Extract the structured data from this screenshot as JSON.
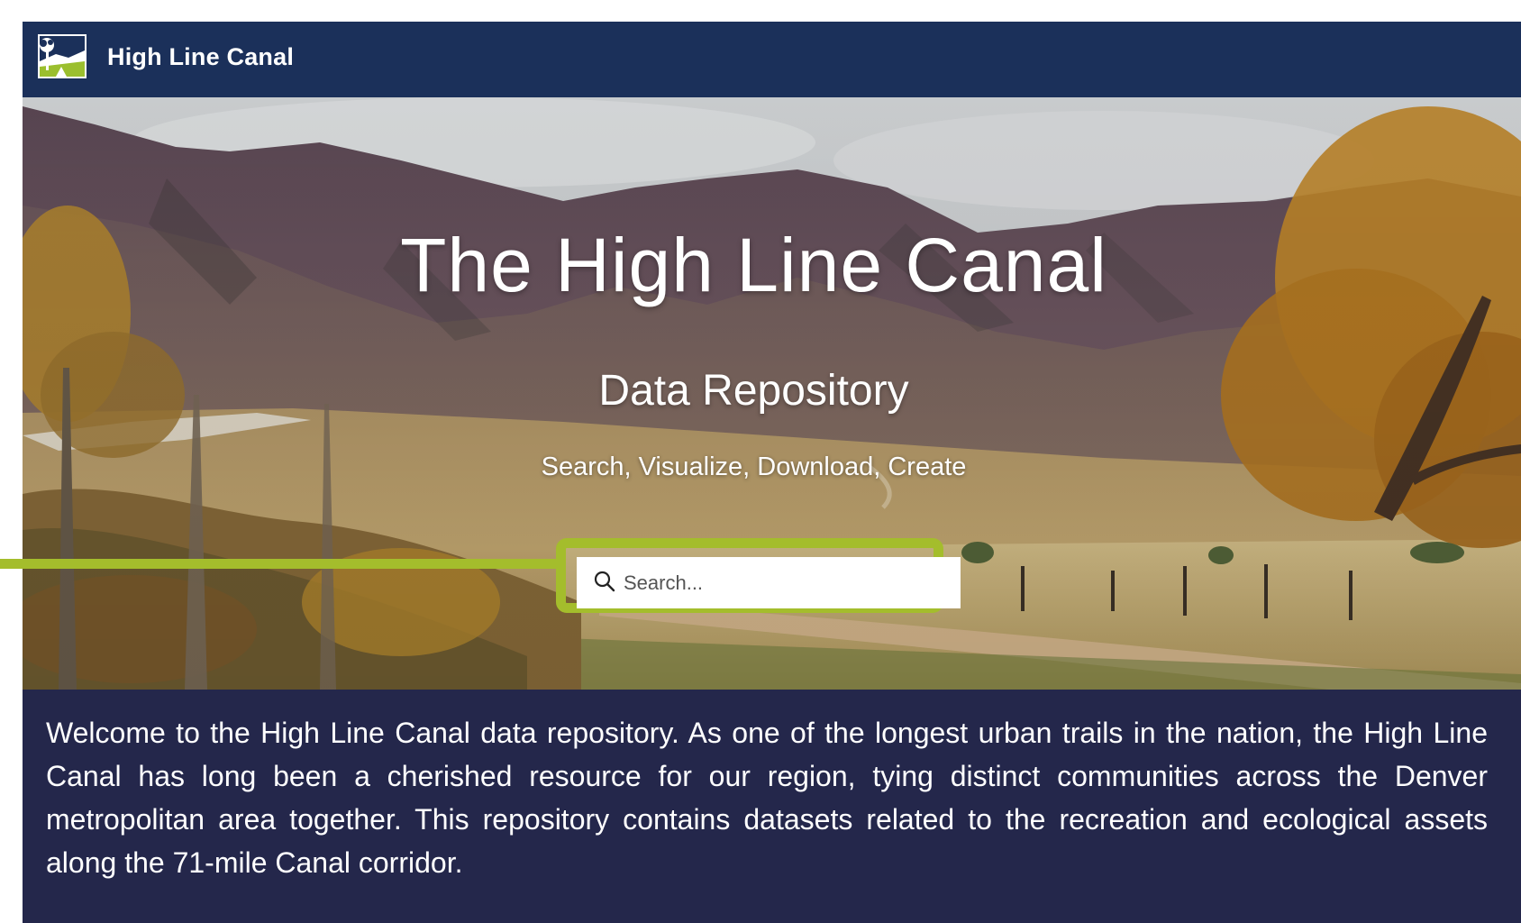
{
  "header": {
    "site_title": "High Line Canal",
    "logo_icon": "tree-landscape-logo-icon"
  },
  "hero": {
    "title": "The High Line Canal",
    "subtitle": "Data Repository",
    "tagline": "Search, Visualize, Download, Create",
    "search": {
      "placeholder": "Search...",
      "value": "",
      "icon": "search-icon"
    },
    "highlight_color": "#a4bd2c"
  },
  "welcome": {
    "text": "Welcome to the High Line Canal data repository. As one of the longest urban trails in the nation, the High Line Canal has long been a cherished resource for our region, tying distinct communities across the Denver metropolitan area together. This repository contains datasets related to the recreation and ecological assets along the 71-mile Canal corridor."
  },
  "colors": {
    "navbar_bg": "#1b305a",
    "welcome_bg": "#24274b",
    "accent": "#a4bd2c"
  }
}
